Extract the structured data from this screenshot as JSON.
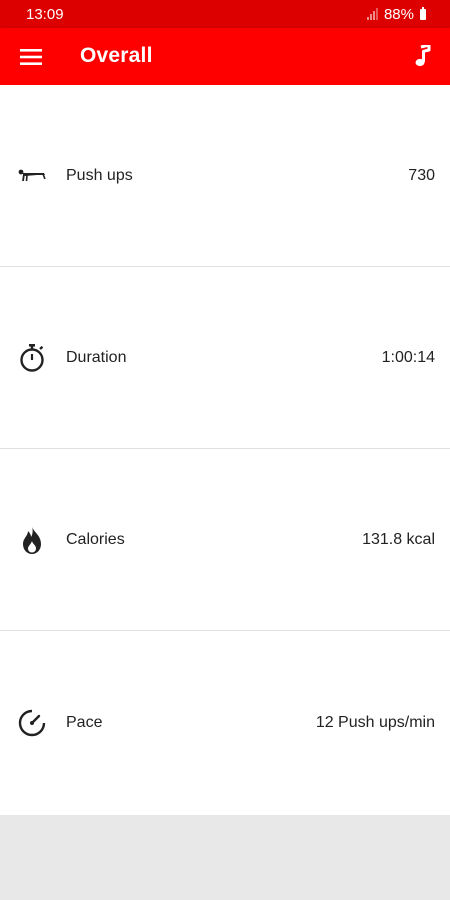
{
  "status_bar": {
    "time": "13:09",
    "battery": "88%"
  },
  "app_bar": {
    "title": "Overall",
    "menu_icon": "hamburger-menu-icon",
    "music_icon": "music-note-icon"
  },
  "stats": [
    {
      "icon": "pushup-icon",
      "label": "Push ups",
      "value": "730"
    },
    {
      "icon": "stopwatch-icon",
      "label": "Duration",
      "value": "1:00:14"
    },
    {
      "icon": "flame-icon",
      "label": "Calories",
      "value": "131.8 kcal"
    },
    {
      "icon": "speedometer-icon",
      "label": "Pace",
      "value": "12 Push ups/min"
    }
  ],
  "colors": {
    "status_bar": "#dc0000",
    "app_bar": "#ff0000",
    "background": "#e8e8e8"
  }
}
